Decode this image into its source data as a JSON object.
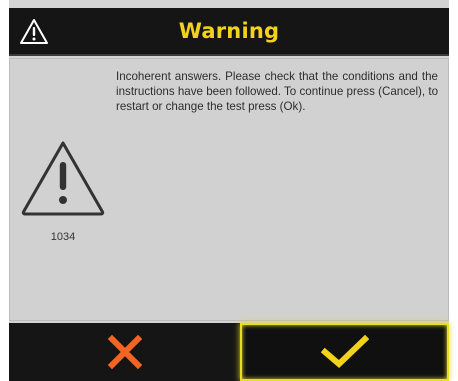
{
  "dialog": {
    "title": "Warning",
    "message": "Incoherent answers. Please check that the conditions and the instructions have been followed. To continue press (Cancel), to restart or change the test press (Ok).",
    "code": "1034",
    "icons": {
      "header": "warning-icon",
      "body": "warning-icon"
    }
  },
  "buttons": {
    "cancel": {
      "icon": "close-icon",
      "color": "#f26522"
    },
    "ok": {
      "icon": "check-icon",
      "color": "#f2d21a"
    }
  },
  "colors": {
    "title_text": "#f2d21a",
    "title_bar": "#151515",
    "content_bg": "#d1d1d1",
    "ok_highlight": "#e8df20"
  }
}
